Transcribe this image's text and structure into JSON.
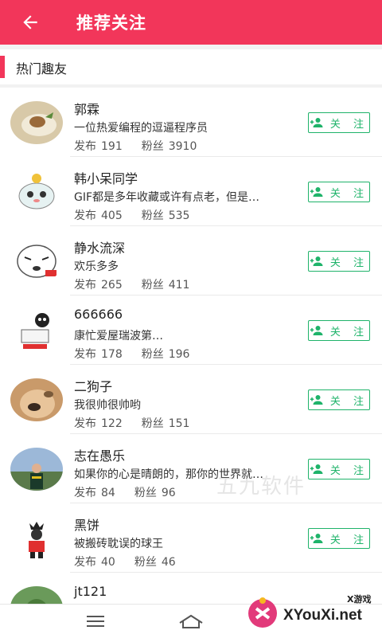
{
  "header": {
    "title": "推荐关注",
    "back_icon": "arrow-left-icon",
    "bg_color": "#f2365a"
  },
  "section": {
    "label": "热门趣友"
  },
  "follow_label": "关 注",
  "stats_labels": {
    "posts": "发布",
    "fans": "粉丝"
  },
  "users": [
    {
      "name": "郭霖",
      "desc": "一位热爱编程的逗逼程序员",
      "posts": "191",
      "fans": "3910"
    },
    {
      "name": "韩小呆同学",
      "desc": "GIF都是多年收藏或许有点老，但是…",
      "posts": "405",
      "fans": "535"
    },
    {
      "name": "静水流深",
      "desc": "欢乐多多",
      "posts": "265",
      "fans": "411"
    },
    {
      "name": "666666",
      "desc": "康忙爱屋瑞波第…",
      "posts": "178",
      "fans": "196"
    },
    {
      "name": "二狗子",
      "desc": "我很帅很帅哟",
      "posts": "122",
      "fans": "151"
    },
    {
      "name": "志在愚乐",
      "desc": "如果你的心是晴朗的，那你的世界就…",
      "posts": "84",
      "fans": "96"
    },
    {
      "name": "黑饼",
      "desc": "被搬砖耽误的球王",
      "posts": "40",
      "fans": "46"
    },
    {
      "name": "jt121",
      "desc": "",
      "posts": "",
      "fans": ""
    }
  ],
  "watermark": {
    "text": "XYouXi.net",
    "sub": "X游戏",
    "ghost": "五九软件"
  },
  "accent_green": "#1fb36a"
}
